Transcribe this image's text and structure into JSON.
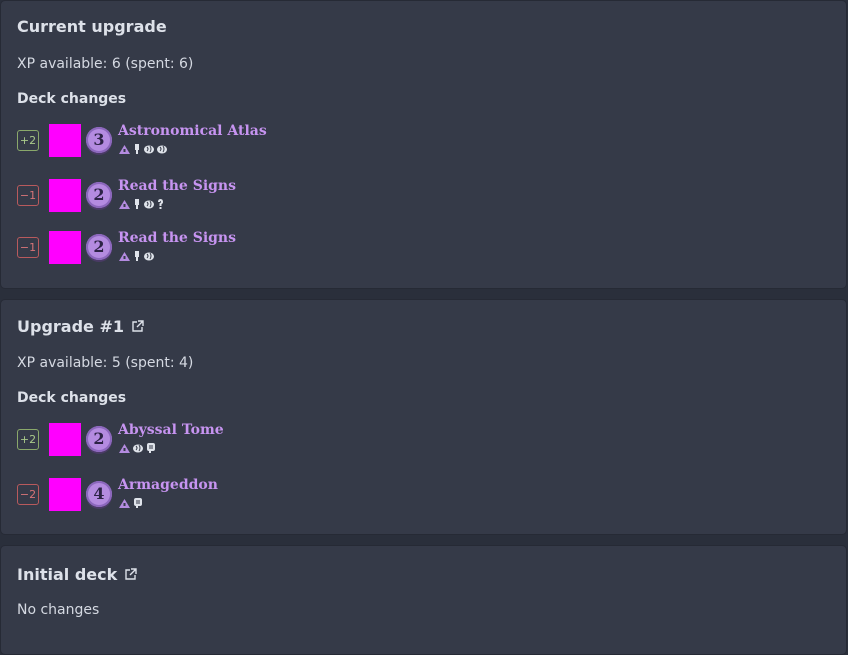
{
  "sections": [
    {
      "title": "Current upgrade",
      "has_external_link": false,
      "xp_text": "XP available: 6 (spent: 6)",
      "deck_changes_label": "Deck changes",
      "changes": [
        {
          "badge": "+2",
          "kind": "plus",
          "cost": "3",
          "name": "Astronomical Atlas",
          "icons": [
            "seeker-class-icon",
            "willpower-icon",
            "intellect-icon",
            "intellect-icon"
          ]
        },
        {
          "badge": "−1",
          "kind": "minus",
          "cost": "2",
          "name": "Read the Signs",
          "icons": [
            "seeker-class-icon",
            "willpower-icon",
            "intellect-icon",
            "wild-icon"
          ]
        },
        {
          "badge": "−1",
          "kind": "minus",
          "cost": "2",
          "name": "Read the Signs",
          "icons": [
            "seeker-class-icon",
            "willpower-icon",
            "intellect-icon"
          ]
        }
      ]
    },
    {
      "title": "Upgrade #1",
      "has_external_link": true,
      "xp_text": "XP available: 5 (spent: 4)",
      "deck_changes_label": "Deck changes",
      "changes": [
        {
          "badge": "+2",
          "kind": "plus",
          "cost": "2",
          "name": "Abyssal Tome",
          "icons": [
            "seeker-class-icon",
            "intellect-icon",
            "combat-icon"
          ]
        },
        {
          "badge": "−2",
          "kind": "minus",
          "cost": "4",
          "name": "Armageddon",
          "icons": [
            "seeker-class-icon",
            "combat-icon"
          ]
        }
      ]
    },
    {
      "title": "Initial deck",
      "has_external_link": true,
      "status_text": "No changes"
    }
  ],
  "colors": {
    "page_bg": "#2a2f3b",
    "panel_bg": "#353a48",
    "card_name": "#c794f1",
    "cost_coin": "#b48be0",
    "badge_plus": "#a9c98a",
    "badge_minus": "#d67478",
    "card_thumb": "#ff00ff"
  }
}
